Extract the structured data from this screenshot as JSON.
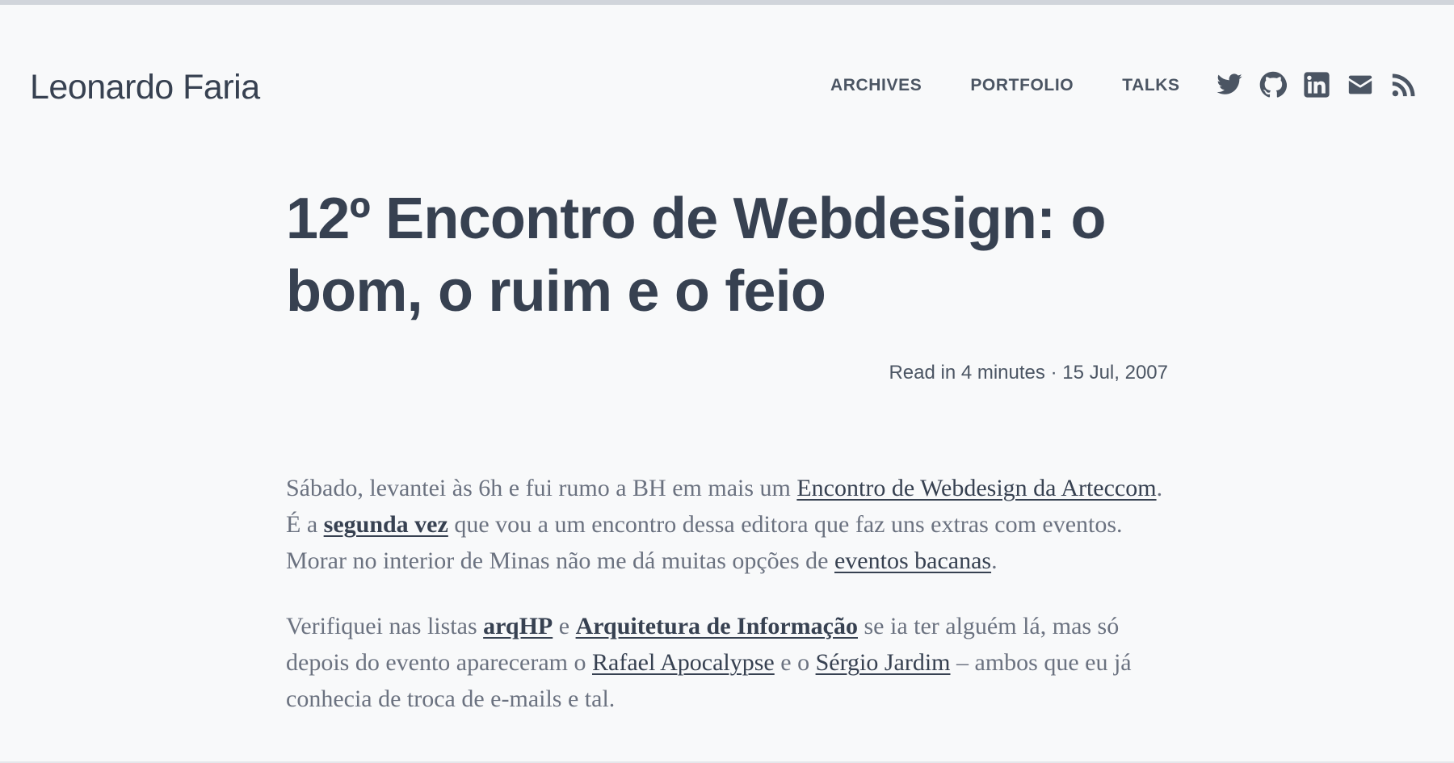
{
  "site": {
    "title": "Leonardo Faria"
  },
  "nav": [
    {
      "label": "ARCHIVES"
    },
    {
      "label": "PORTFOLIO"
    },
    {
      "label": "TALKS"
    }
  ],
  "social": [
    {
      "icon": "twitter-icon"
    },
    {
      "icon": "github-icon"
    },
    {
      "icon": "linkedin-icon"
    },
    {
      "icon": "email-icon"
    },
    {
      "icon": "rss-icon"
    }
  ],
  "post": {
    "title": "12º Encontro de Webdesign: o bom, o ruim e o feio",
    "meta": "Read in 4 minutes · 15 Jul, 2007",
    "p1": {
      "t1": "Sábado, levantei às 6h e fui rumo a BH em mais um ",
      "l1": "Encontro de Webdesign da Arteccom",
      "t2": ". É a ",
      "l2": "segunda vez",
      "t3": " que vou a um encontro dessa editora que faz uns extras com eventos. Morar no interior de Minas não me dá muitas opções de ",
      "l3": "eventos bacanas",
      "t4": "."
    },
    "p2": {
      "t1": "Verifiquei nas listas ",
      "l1": "arqHP",
      "t2": " e ",
      "l2": "Arquitetura de Informação",
      "t3": " se ia ter alguém lá, mas só depois do evento apareceram o ",
      "l3": "Rafael Apocalypse",
      "t4": " e o ",
      "l4": "Sérgio Jardim",
      "t5": " – ambos que eu já conhecia de troca de e-mails e tal."
    }
  },
  "colors": {
    "background": "#f8f9fa",
    "text_dark": "#374151",
    "text_body": "#6b7280",
    "top_border": "#d1d5db"
  }
}
